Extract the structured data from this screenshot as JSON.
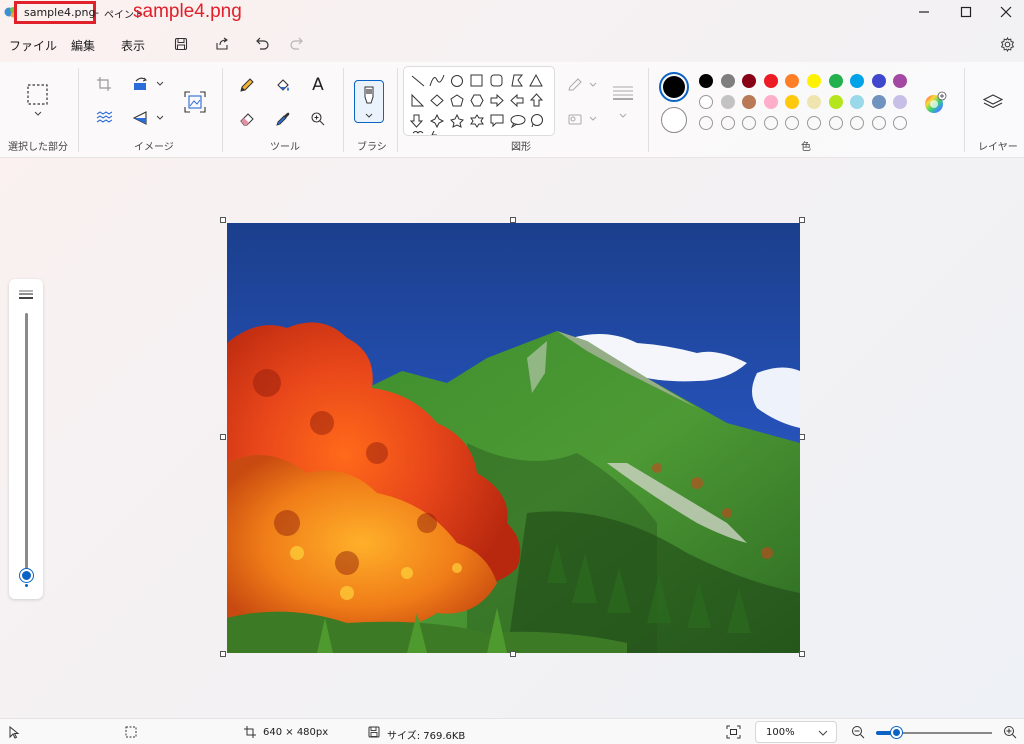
{
  "titlebar": {
    "file_name": "sample4.png",
    "separator": "-",
    "app_name": "ペイント",
    "annotation": "sample4.png"
  },
  "menu": {
    "file": "ファイル",
    "edit": "編集",
    "view": "表示"
  },
  "ribbon": {
    "selection_label": "選択した部分",
    "image_label": "イメージ",
    "tools_label": "ツール",
    "brush_label": "ブラシ",
    "shapes_label": "図形",
    "colors_label": "色",
    "layers_label": "レイヤー",
    "tools_text_glyph": "A",
    "colors": {
      "primary": "#000000",
      "secondary": "#ffffff",
      "palette_row1": [
        "#000000",
        "#7f7f7f",
        "#880015",
        "#ed1c24",
        "#ff7f27",
        "#fff200",
        "#22b14c",
        "#00a2e8",
        "#3f48cc",
        "#a349a4"
      ],
      "palette_row2": [
        "#ffffff",
        "#c3c3c3",
        "#b97a57",
        "#ffaec9",
        "#ffc90e",
        "#efe4b0",
        "#b5e61d",
        "#99d9ea",
        "#7092be",
        "#c8bfe7"
      ]
    }
  },
  "status": {
    "dimensions": "640 × 480px",
    "size": "サイズ: 769.6KB",
    "zoom": "100%",
    "zoom_percent": 100
  }
}
